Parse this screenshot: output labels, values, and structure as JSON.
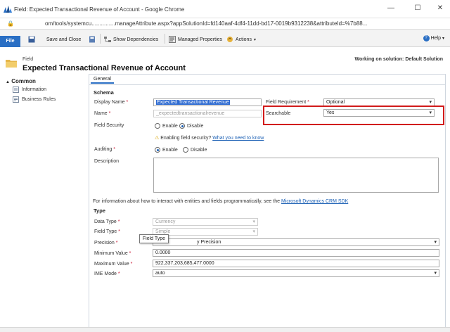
{
  "window": {
    "title": "Field: Expected Transactional Revenue of Account - Google Chrome",
    "minimize": "—",
    "maximize": "☐",
    "close": "✕"
  },
  "urlbar": {
    "url": "om/tools/systemcu...............manageAttribute.aspx?appSolutionId=fd140aaf-4df4-11dd-bd17-0019b9312238&attributeId=%7b88..."
  },
  "ribbon": {
    "file": "File",
    "save_close": "Save and Close",
    "show_dependencies": "Show Dependencies",
    "managed_properties": "Managed Properties",
    "actions": "Actions",
    "help": "Help"
  },
  "header": {
    "entity_type": "Field",
    "entity_name": "Expected Transactional Revenue of Account",
    "solution": "Working on solution: Default Solution"
  },
  "leftnav": {
    "section": "Common",
    "items": [
      {
        "label": "Information",
        "icon": "information-icon"
      },
      {
        "label": "Business Rules",
        "icon": "business-rules-icon"
      }
    ]
  },
  "tabs": {
    "general": "General"
  },
  "schema": {
    "heading": "Schema",
    "display_name_label": "Display Name",
    "display_name_value": "Expected Transactional Revenue",
    "field_requirement_label": "Field Requirement",
    "field_requirement_value": "Optional",
    "name_label": "Name",
    "name_value": "_expectedtransactionalrevenue",
    "searchable_label": "Searchable",
    "searchable_value": "Yes",
    "field_security_label": "Field Security",
    "enable": "Enable",
    "disable": "Disable",
    "field_security_note": "Enabling field security?",
    "field_security_link": "What you need to know",
    "auditing_label": "Auditing",
    "description_label": "Description",
    "info_text": "For information about how to interact with entities and fields programmatically, see the",
    "sdk_link": "Microsoft Dynamics CRM SDK"
  },
  "type_section": {
    "heading": "Type",
    "data_type_label": "Data Type",
    "data_type_value": "Currency",
    "field_type_label": "Field Type",
    "field_type_value": "Simple",
    "precision_label": "Precision",
    "precision_value": "y Precision",
    "min_value_label": "Minimum Value",
    "min_value": "0.0000",
    "max_value_label": "Maximum Value",
    "max_value": "922,337,203,685,477.0000",
    "ime_mode_label": "IME Mode",
    "ime_mode_value": "auto",
    "tooltip": "Field Type"
  },
  "colors": {
    "file_tab": "#2a6fc4",
    "highlight_box": "#d11a1a",
    "link": "#1a5fb4",
    "required": "#c8102e"
  }
}
